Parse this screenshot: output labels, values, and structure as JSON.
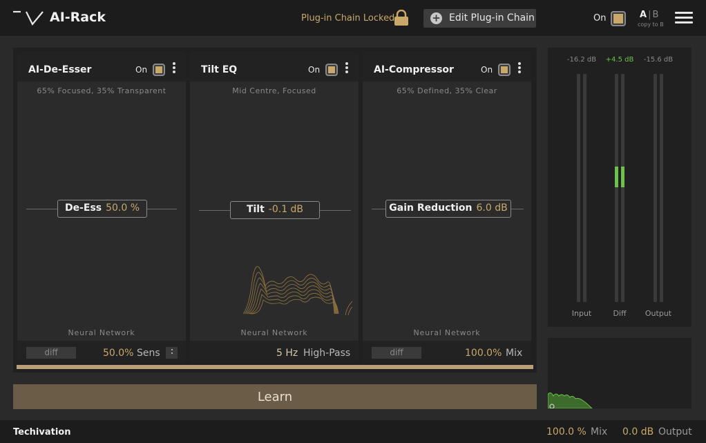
{
  "header": {
    "app_title": "AI-Rack",
    "chain_locked_label": "Plug-in Chain Locked",
    "edit_chain_label": "Edit Plug-in Chain",
    "on_label": "On",
    "ab_a": "A",
    "ab_sep": "|",
    "ab_b": "B",
    "copy_label": "copy to B"
  },
  "modules": [
    {
      "title": "AI-De-Esser",
      "on_label": "On",
      "subtitle": "65% Focused, 35% Transparent",
      "control_name": "De-Ess",
      "control_value": "50.0 %",
      "network_label": "Neural Network",
      "diff_label": "diff",
      "footer_value": "50.0%",
      "footer_label": "Sens"
    },
    {
      "title": "Tilt EQ",
      "on_label": "On",
      "subtitle": "Mid Centre, Focused",
      "control_name": "Tilt",
      "control_value": "-0.1 dB",
      "network_label": "Neural Network",
      "footer_value": "5 Hz",
      "footer_label": "High-Pass"
    },
    {
      "title": "AI-Compressor",
      "on_label": "On",
      "subtitle": "65% Defined, 35% Clear",
      "control_name": "Gain Reduction",
      "control_value": "6.0 dB",
      "network_label": "Neural Network",
      "diff_label": "diff",
      "footer_value": "100.0%",
      "footer_label": "Mix"
    }
  ],
  "learn_label": "Learn",
  "meters": [
    {
      "db": "-16.2 dB",
      "label": "Input",
      "color": "#8a8a8a"
    },
    {
      "db": "+4.5 dB",
      "label": "Diff",
      "color": "#6cc24a"
    },
    {
      "db": "-15.6 dB",
      "label": "Output",
      "color": "#8a8a8a"
    }
  ],
  "footer": {
    "brand": "Techivation",
    "mix_value": "100.0 %",
    "mix_label": "Mix",
    "output_value": "0.0 dB",
    "output_label": "Output"
  },
  "colors": {
    "accent": "#c9a86a",
    "meter_green": "#6cc24a",
    "learn_bg": "#6b5c47"
  }
}
